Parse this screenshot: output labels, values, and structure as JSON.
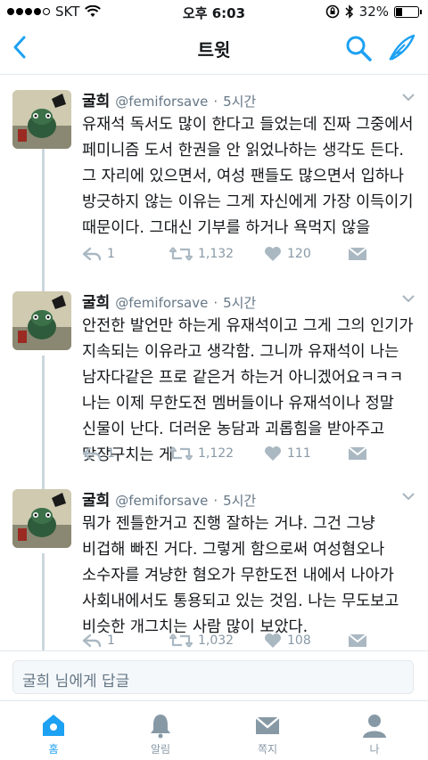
{
  "status_bar": {
    "carrier": "SKT",
    "time": "오후 6:03",
    "battery": "32%",
    "battery_level": 0.32
  },
  "header": {
    "title": "트윗",
    "back_icon": "chevron-left-icon",
    "search_icon": "search-icon",
    "compose_icon": "compose-tweet-icon"
  },
  "colors": {
    "accent": "#1da1f2",
    "muted": "#8899a6"
  },
  "tweets": [
    {
      "name": "굴희",
      "handle": "@femiforsave",
      "time": "5시간",
      "text": "유재석 독서도 많이 한다고 들었는데 진짜 그중에서 페미니즘 도서 한권을 안 읽었나하는 생각도 든다. 그 자리에 있으면서, 여성 팬들도 많으면서 입하나 방긋하지 않는 이유는 그게 자신에게 가장 이득이기 때문이다. 그대신 기부를 하거나 욕먹지 않을",
      "replies": "1",
      "retweets": "1,132",
      "likes": "120"
    },
    {
      "name": "굴희",
      "handle": "@femiforsave",
      "time": "5시간",
      "text": "안전한 발언만 하는게 유재석이고 그게 그의 인기가 지속되는 이유라고 생각함. 그니까 유재석이 나는 남자다같은 프로 같은거 하는거 아니겠어요ㅋㅋㅋ 나는 이제 무한도전 멤버들이나 유재석이나 정말 신물이 난다. 더러운 농담과 괴롭힘을 받아주고 맞장구치는 게",
      "replies": "1",
      "retweets": "1,122",
      "likes": "111"
    },
    {
      "name": "굴희",
      "handle": "@femiforsave",
      "time": "5시간",
      "text": "뭐가 젠틀한거고 진행 잘하는 거냐. 그건 그냥 비겁해 빠진 거다. 그렇게 함으로써 여성혐오나 소수자를 겨냥한 혐오가 무한도전 내에서 나아가 사회내에서도 통용되고 있는 것임. 나는 무도보고 비슷한 개그치는 사람 많이 보았다.",
      "replies": "1",
      "retweets": "1,032",
      "likes": "108"
    }
  ],
  "reply": {
    "placeholder": "굴희 님에게 답글"
  },
  "tabs": [
    {
      "label": "홈",
      "icon": "home-icon"
    },
    {
      "label": "알림",
      "icon": "bell-icon"
    },
    {
      "label": "쪽지",
      "icon": "envelope-icon"
    },
    {
      "label": "나",
      "icon": "person-icon"
    }
  ]
}
